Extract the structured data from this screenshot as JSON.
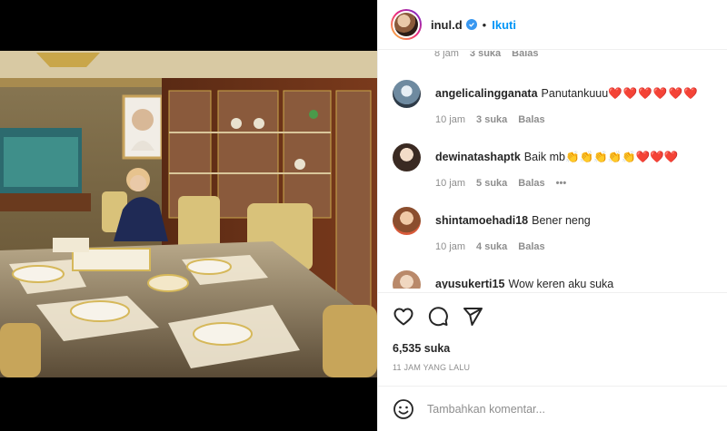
{
  "header": {
    "username": "inul.d",
    "separator": "•",
    "follow_label": "Ikuti"
  },
  "top_meta": {
    "time": "8 jam",
    "likes": "3 suka",
    "reply": "Balas"
  },
  "comments": [
    {
      "user": "angelicalingganata",
      "text": "Panutankuuu",
      "emoji": "❤️❤️❤️❤️❤️❤️",
      "time": "10 jam",
      "likes": "3 suka",
      "reply": "Balas",
      "avatar_color": "#8fa7b8"
    },
    {
      "user": "dewinatashaptk",
      "text": "Baik mb",
      "emoji": "👏👏👏👏👏❤️❤️❤️",
      "time": "10 jam",
      "likes": "5 suka",
      "reply": "Balas",
      "more": "•••",
      "avatar_color": "#c9a58f"
    },
    {
      "user": "shintamoehadi18",
      "text": "Bener neng",
      "emoji": "",
      "time": "10 jam",
      "likes": "4 suka",
      "reply": "Balas",
      "avatar_color": "#b8845e"
    },
    {
      "user": "ayusukerti15",
      "text": "Wow keren aku suka",
      "emoji": "",
      "time": "",
      "likes": "",
      "reply": "",
      "avatar_color": "#d6b59a"
    }
  ],
  "actions": {
    "like_count": "6,535 suka",
    "time_ago": "11 JAM YANG LALU"
  },
  "add_comment": {
    "placeholder": "Tambahkan komentar..."
  },
  "colors": {
    "accent": "#0095f6",
    "verified": "#3897f0",
    "muted": "#8e8e8e",
    "heart": "#e0245e"
  },
  "icons": [
    "heart-icon",
    "comment-icon",
    "share-icon",
    "emoji-icon",
    "verified-badge-icon"
  ]
}
